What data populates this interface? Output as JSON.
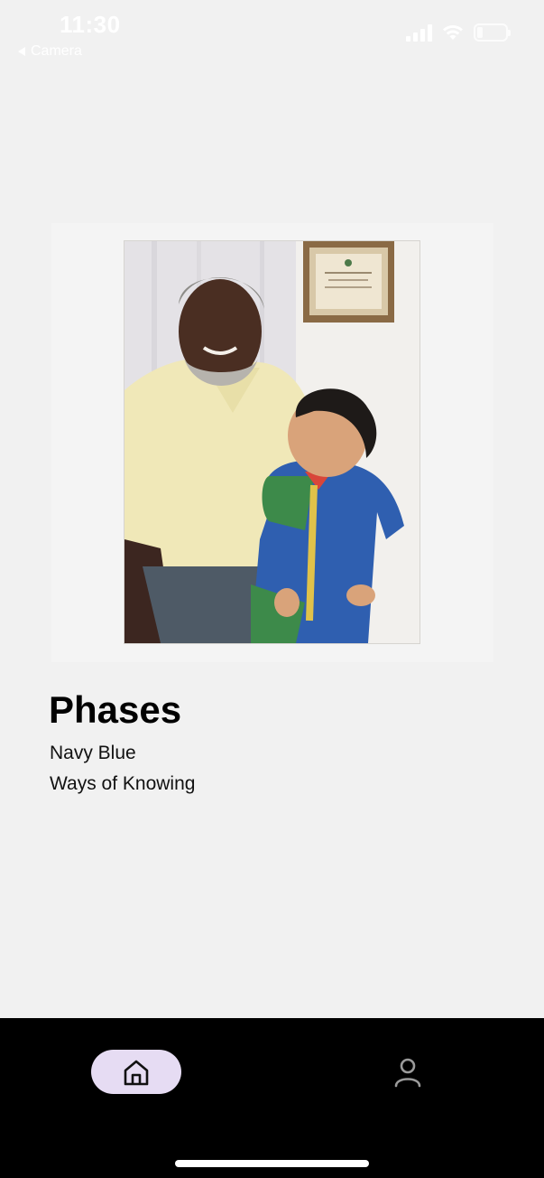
{
  "status_bar": {
    "time": "11:30",
    "back_label": "Camera",
    "icons": [
      "cellular-signal-icon",
      "wifi-icon",
      "battery-icon"
    ]
  },
  "artwork": {
    "image_description_icon": "photo-artwork"
  },
  "album": {
    "title": "Phases",
    "artist": "Navy Blue",
    "label": "Ways of Knowing"
  },
  "bottom_nav": {
    "items": [
      {
        "icon": "home-icon",
        "active": true
      },
      {
        "icon": "profile-icon",
        "active": false
      }
    ],
    "active_pill_color": "#e6dcf3"
  }
}
